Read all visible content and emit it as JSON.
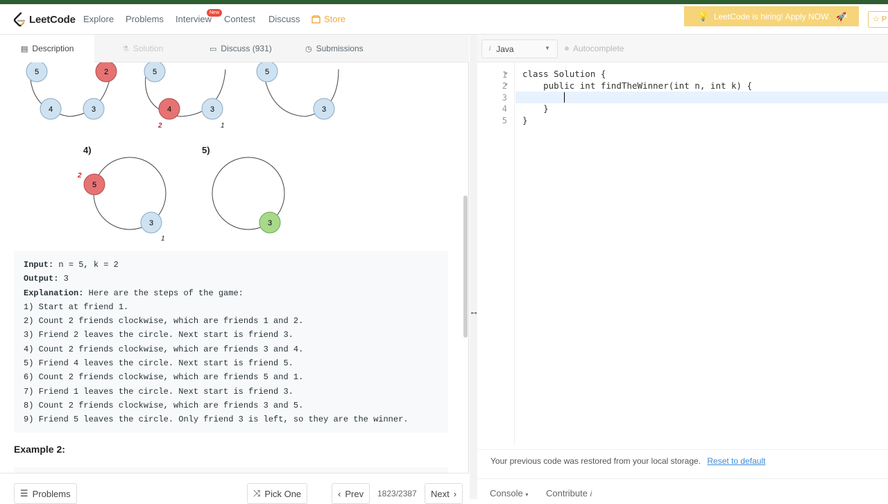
{
  "nav": {
    "logo": "LeetCode",
    "items": [
      "Explore",
      "Problems",
      "Interview",
      "Contest",
      "Discuss"
    ],
    "new_badge": "New",
    "store": "Store",
    "hiring": "LeetCode is hiring! Apply NOW.",
    "hiring_close": "×",
    "star_label": "☆ P"
  },
  "tabs": {
    "description": "Description",
    "solution": "Solution",
    "discuss": "Discuss (931)",
    "submissions": "Submissions"
  },
  "diagram": {
    "step4": "4)",
    "step5": "5)",
    "nodes": {
      "a": "5",
      "b": "2",
      "c": "4",
      "d": "3",
      "e": "5",
      "f": "4",
      "g": "3",
      "h": "5",
      "i": "3",
      "j": "5",
      "k": "3",
      "l": "3"
    },
    "counts": {
      "c1": "2",
      "c2": "1",
      "c3": "2",
      "c4": "1"
    }
  },
  "example1": {
    "input_label": "Input:",
    "input_value": " n = 5, k = 2",
    "output_label": "Output:",
    "output_value": " 3",
    "explanation_label": "Explanation:",
    "explanation_value": " Here are the steps of the game:",
    "steps": [
      "1) Start at friend 1.",
      "2) Count 2 friends clockwise, which are friends 1 and 2.",
      "3) Friend 2 leaves the circle. Next start is friend 3.",
      "4) Count 2 friends clockwise, which are friends 3 and 4.",
      "5) Friend 4 leaves the circle. Next start is friend 5.",
      "6) Count 2 friends clockwise, which are friends 5 and 1.",
      "7) Friend 1 leaves the circle. Next start is friend 3.",
      "8) Count 2 friends clockwise, which are friends 3 and 5.",
      "9) Friend 5 leaves the circle. Only friend 3 is left, so they are the winner."
    ]
  },
  "example2_title": "Example 2:",
  "footer": {
    "problems": "Problems",
    "pick_one": "Pick One",
    "prev": "Prev",
    "counter": "1823/2387",
    "next": "Next"
  },
  "editor": {
    "language": "Java",
    "autocomplete": "Autocomplete",
    "line_numbers": [
      "1",
      "2",
      "3",
      "4",
      "5"
    ],
    "lines": [
      "class Solution {",
      "    public int findTheWinner(int n, int k) {",
      "        ",
      "    }",
      "}"
    ],
    "restore_msg": "Your previous code was restored from your local storage.",
    "reset_link": "Reset to default",
    "console": "Console",
    "contribute": "Contribute"
  }
}
